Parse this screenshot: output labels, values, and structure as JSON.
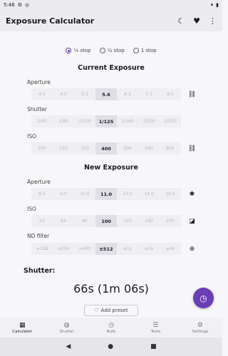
{
  "status": {
    "time": "5:46"
  },
  "app": {
    "title": "Exposure Calculator"
  },
  "stops": {
    "options": [
      "⅓ stop",
      "½ stop",
      "1 stop"
    ],
    "selected": 0
  },
  "current": {
    "title": "Current Exposure",
    "aperture": {
      "label": "Aperture",
      "values": [
        "4.0",
        "4.5",
        "5.0",
        "5.6",
        "6.3",
        "7.1",
        "8.0"
      ],
      "selected": 3
    },
    "shutter": {
      "label": "Shutter",
      "values": [
        "1/60",
        "1/80",
        "1/100",
        "1/125",
        "1/160",
        "1/200",
        "1/250"
      ],
      "selected": 3
    },
    "iso": {
      "label": "ISO",
      "values": [
        "200",
        "250",
        "320",
        "400",
        "500",
        "640",
        "800"
      ],
      "selected": 3
    }
  },
  "new": {
    "title": "New Exposure",
    "aperture": {
      "label": "Aperture",
      "values": [
        "8.0",
        "9.0",
        "10.0",
        "11.0",
        "13.0",
        "14.0",
        "16.0"
      ],
      "selected": 3
    },
    "iso": {
      "label": "ISO",
      "values": [
        "50",
        "64",
        "80",
        "100",
        "125",
        "160",
        "200"
      ],
      "selected": 3
    },
    "nd": {
      "label": "ND filter",
      "values": [
        "≡128",
        "≡256",
        "≡400",
        "≡512",
        "≡1x",
        "≡2x",
        "≡4x"
      ],
      "selected": 3
    }
  },
  "result": {
    "label": "Shutter:",
    "value": "66s (1m 06s)"
  },
  "preset": {
    "label": "Add preset"
  },
  "nav": [
    {
      "label": "Calculator",
      "icon": "calculator-icon",
      "active": true
    },
    {
      "label": "Shutter",
      "icon": "shutter-icon",
      "active": false
    },
    {
      "label": "Bulb",
      "icon": "clock-icon",
      "active": false
    },
    {
      "label": "Tools",
      "icon": "sliders-icon",
      "active": false
    },
    {
      "label": "Settings",
      "icon": "gear-icon",
      "active": false
    }
  ],
  "colors": {
    "accent": "#6a3fb5",
    "background": "#f7f6f9",
    "cell": "#efeef2",
    "cell_selected": "#e0dfe6"
  }
}
